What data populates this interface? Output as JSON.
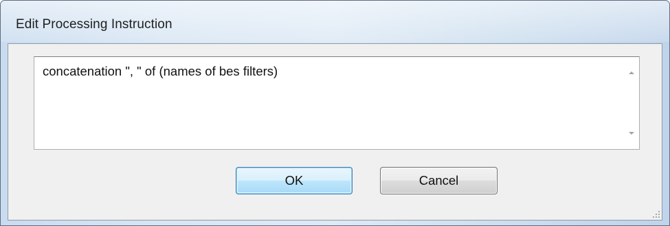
{
  "dialog": {
    "title": "Edit Processing Instruction"
  },
  "editor": {
    "value": "concatenation \", \" of (names of bes filters)",
    "scroll_up_icon": "scroll-up-arrow",
    "scroll_down_icon": "scroll-down-arrow"
  },
  "buttons": {
    "ok_label": "OK",
    "cancel_label": "Cancel"
  },
  "colors": {
    "titlebar": "#d8e6f4",
    "client_background": "#f0f0f0",
    "default_button_border": "#3c7fb1"
  }
}
